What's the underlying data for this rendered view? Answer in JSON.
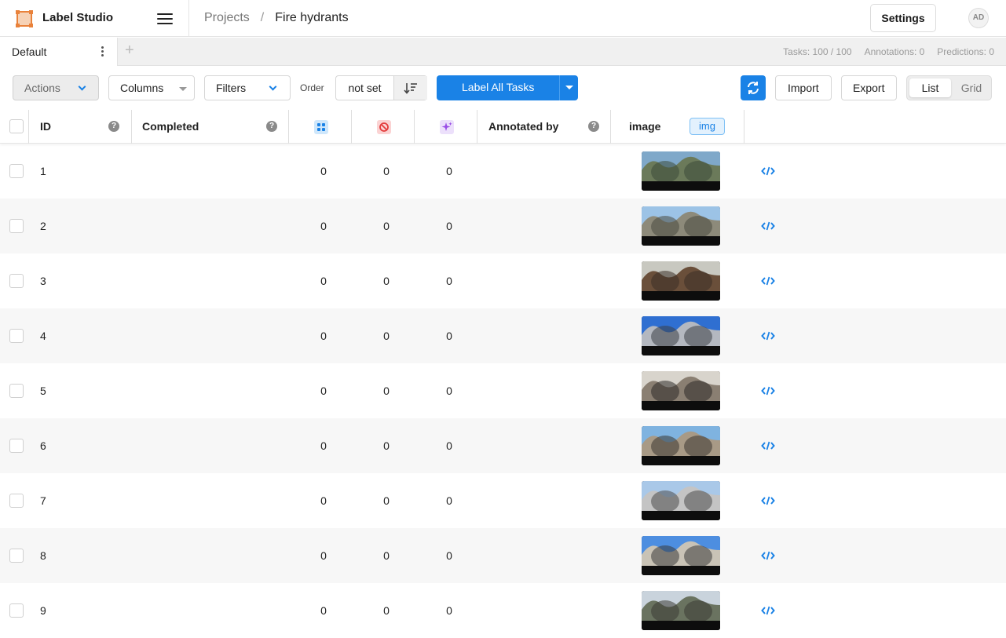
{
  "app": {
    "name": "Label Studio",
    "accent": "#1a82e6",
    "logo_color": "#e9823b"
  },
  "breadcrumb": {
    "projects": "Projects",
    "separator": "/",
    "current": "Fire hydrants"
  },
  "header": {
    "settings_label": "Settings",
    "avatar_initials": "AD"
  },
  "tabs": {
    "active": "Default",
    "add_icon": "plus-icon"
  },
  "stats": {
    "tasks": "Tasks: 100 / 100",
    "annotations": "Annotations: 0",
    "predictions": "Predictions: 0"
  },
  "toolbar": {
    "actions": "Actions",
    "columns": "Columns",
    "filters": "Filters",
    "order_label": "Order",
    "order_value": "not set",
    "label_all": "Label All Tasks",
    "import": "Import",
    "export": "Export",
    "view_list": "List",
    "view_grid": "Grid"
  },
  "table": {
    "headers": {
      "id": "ID",
      "completed": "Completed",
      "total_annotations_icon": "annotations-icon",
      "cancelled_icon": "cancelled-icon",
      "predictions_icon": "predictions-icon",
      "annotated_by": "Annotated by",
      "image": "image",
      "image_tag": "img",
      "help": "?"
    },
    "rows": [
      {
        "id": "1",
        "annotations": "0",
        "cancelled": "0",
        "predictions": "0",
        "palette": [
          "#7fa8c9",
          "#6b7a5a",
          "#3d4a3a"
        ]
      },
      {
        "id": "2",
        "annotations": "0",
        "cancelled": "0",
        "predictions": "0",
        "palette": [
          "#9cc3e6",
          "#8d8a7a",
          "#4a4a40"
        ]
      },
      {
        "id": "3",
        "annotations": "0",
        "cancelled": "0",
        "predictions": "0",
        "palette": [
          "#c8c8c0",
          "#6a4f3a",
          "#3a2f26"
        ]
      },
      {
        "id": "4",
        "annotations": "0",
        "cancelled": "0",
        "predictions": "0",
        "palette": [
          "#2f6fd1",
          "#b4b8c0",
          "#3c3f46"
        ]
      },
      {
        "id": "5",
        "annotations": "0",
        "cancelled": "0",
        "predictions": "0",
        "palette": [
          "#d8d4cc",
          "#8a7f72",
          "#2d2a28"
        ]
      },
      {
        "id": "6",
        "annotations": "0",
        "cancelled": "0",
        "predictions": "0",
        "palette": [
          "#7fb3e0",
          "#a89a86",
          "#3a3632"
        ]
      },
      {
        "id": "7",
        "annotations": "0",
        "cancelled": "0",
        "predictions": "0",
        "palette": [
          "#a9c8e8",
          "#c4c4c4",
          "#4c4c4c"
        ]
      },
      {
        "id": "8",
        "annotations": "0",
        "cancelled": "0",
        "predictions": "0",
        "palette": [
          "#4d8ee0",
          "#c9c3b6",
          "#3a3a3a"
        ]
      },
      {
        "id": "9",
        "annotations": "0",
        "cancelled": "0",
        "predictions": "0",
        "palette": [
          "#c9d3dc",
          "#6a7360",
          "#3a3a34"
        ]
      }
    ]
  }
}
